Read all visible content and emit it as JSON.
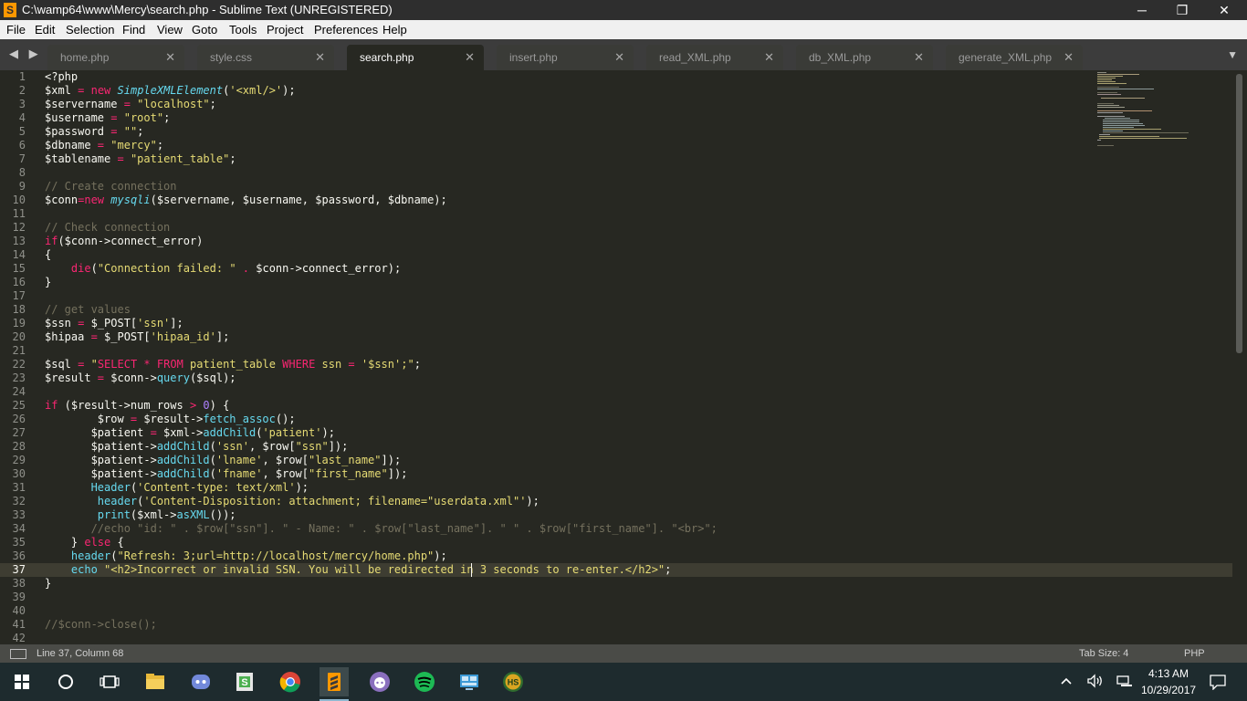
{
  "window": {
    "title": "C:\\wamp64\\www\\Mercy\\search.php - Sublime Text (UNREGISTERED)",
    "app_icon_letter": "S",
    "minimize_glyph": "─",
    "maximize_glyph": "❐",
    "close_glyph": "✕"
  },
  "menu": [
    {
      "label": "File"
    },
    {
      "label": "Edit"
    },
    {
      "label": "Selection"
    },
    {
      "label": "Find"
    },
    {
      "label": "View"
    },
    {
      "label": "Goto"
    },
    {
      "label": "Tools"
    },
    {
      "label": "Project"
    },
    {
      "label": "Preferences"
    },
    {
      "label": "Help"
    }
  ],
  "tab_nav": "◀ ▶",
  "tab_menu_glyph": "▼",
  "tabs": [
    {
      "label": "home.php",
      "close": "✕"
    },
    {
      "label": "style.css",
      "close": "✕"
    },
    {
      "label": "search.php",
      "close": "✕",
      "active": true
    },
    {
      "label": "insert.php",
      "close": "✕"
    },
    {
      "label": "read_XML.php",
      "close": "✕"
    },
    {
      "label": "db_XML.php",
      "close": "✕"
    },
    {
      "label": "generate_XML.php",
      "close": "✕"
    }
  ],
  "editor": {
    "line_numbers": [
      "1",
      "2",
      "3",
      "4",
      "5",
      "6",
      "7",
      "8",
      "9",
      "10",
      "11",
      "12",
      "13",
      "14",
      "15",
      "16",
      "17",
      "18",
      "19",
      "20",
      "21",
      "22",
      "23",
      "24",
      "25",
      "26",
      "27",
      "28",
      "29",
      "30",
      "31",
      "32",
      "33",
      "34",
      "35",
      "36",
      "37",
      "38",
      "39",
      "40",
      "41",
      "42"
    ],
    "current_line": 37,
    "code": [
      [
        {
          "t": "<?php"
        }
      ],
      [
        {
          "t": "$xml "
        },
        {
          "t": "=",
          "c": "kw"
        },
        {
          "t": " "
        },
        {
          "t": "new",
          "c": "kw"
        },
        {
          "t": " "
        },
        {
          "t": "SimpleXMLElement",
          "c": "cls"
        },
        {
          "t": "("
        },
        {
          "t": "'<xml/>'",
          "c": "str"
        },
        {
          "t": ");"
        }
      ],
      [
        {
          "t": "$servername "
        },
        {
          "t": "=",
          "c": "kw"
        },
        {
          "t": " "
        },
        {
          "t": "\"localhost\"",
          "c": "str"
        },
        {
          "t": ";"
        }
      ],
      [
        {
          "t": "$username "
        },
        {
          "t": "=",
          "c": "kw"
        },
        {
          "t": " "
        },
        {
          "t": "\"root\"",
          "c": "str"
        },
        {
          "t": ";"
        }
      ],
      [
        {
          "t": "$password "
        },
        {
          "t": "=",
          "c": "kw"
        },
        {
          "t": " "
        },
        {
          "t": "\"\"",
          "c": "str"
        },
        {
          "t": ";"
        }
      ],
      [
        {
          "t": "$dbname "
        },
        {
          "t": "=",
          "c": "kw"
        },
        {
          "t": " "
        },
        {
          "t": "\"mercy\"",
          "c": "str"
        },
        {
          "t": ";"
        }
      ],
      [
        {
          "t": "$tablename "
        },
        {
          "t": "=",
          "c": "kw"
        },
        {
          "t": " "
        },
        {
          "t": "\"patient_table\"",
          "c": "str"
        },
        {
          "t": ";"
        }
      ],
      [],
      [
        {
          "t": "// Create connection",
          "c": "cmt"
        }
      ],
      [
        {
          "t": "$conn"
        },
        {
          "t": "=",
          "c": "kw"
        },
        {
          "t": "new",
          "c": "kw"
        },
        {
          "t": " "
        },
        {
          "t": "mysqli",
          "c": "cls"
        },
        {
          "t": "($servername, $username, $password, $dbname);"
        }
      ],
      [],
      [
        {
          "t": "// Check connection",
          "c": "cmt"
        }
      ],
      [
        {
          "t": "if",
          "c": "kw"
        },
        {
          "t": "($conn->connect_error)"
        }
      ],
      [
        {
          "t": "{"
        }
      ],
      [
        {
          "t": "    "
        },
        {
          "t": "die",
          "c": "kw"
        },
        {
          "t": "("
        },
        {
          "t": "\"Connection failed: \"",
          "c": "str"
        },
        {
          "t": " "
        },
        {
          "t": ".",
          "c": "kw"
        },
        {
          "t": " $conn->connect_error);"
        }
      ],
      [
        {
          "t": "}"
        }
      ],
      [],
      [
        {
          "t": "// get values",
          "c": "cmt"
        }
      ],
      [
        {
          "t": "$ssn "
        },
        {
          "t": "=",
          "c": "kw"
        },
        {
          "t": " $_POST["
        },
        {
          "t": "'ssn'",
          "c": "str"
        },
        {
          "t": "];"
        }
      ],
      [
        {
          "t": "$hipaa "
        },
        {
          "t": "=",
          "c": "kw"
        },
        {
          "t": " $_POST["
        },
        {
          "t": "'hipaa_id'",
          "c": "str"
        },
        {
          "t": "];"
        }
      ],
      [],
      [
        {
          "t": "$sql "
        },
        {
          "t": "=",
          "c": "kw"
        },
        {
          "t": " "
        },
        {
          "t": "\"",
          "c": "str"
        },
        {
          "t": "SELECT",
          "c": "kw"
        },
        {
          "t": " "
        },
        {
          "t": "*",
          "c": "kw"
        },
        {
          "t": " "
        },
        {
          "t": "FROM",
          "c": "kw"
        },
        {
          "t": " patient_table ",
          "c": "str"
        },
        {
          "t": "WHERE",
          "c": "kw"
        },
        {
          "t": " ssn ",
          "c": "str"
        },
        {
          "t": "=",
          "c": "kw"
        },
        {
          "t": " '$ssn';\"",
          "c": "str"
        },
        {
          "t": ";"
        }
      ],
      [
        {
          "t": "$result "
        },
        {
          "t": "=",
          "c": "kw"
        },
        {
          "t": " $conn->"
        },
        {
          "t": "query",
          "c": "fn"
        },
        {
          "t": "($sql);"
        }
      ],
      [],
      [
        {
          "t": "if",
          "c": "kw"
        },
        {
          "t": " ($result->num_rows "
        },
        {
          "t": ">",
          "c": "kw"
        },
        {
          "t": " "
        },
        {
          "t": "0",
          "c": "num"
        },
        {
          "t": ") {"
        }
      ],
      [
        {
          "t": "        $row "
        },
        {
          "t": "=",
          "c": "kw"
        },
        {
          "t": " $result->"
        },
        {
          "t": "fetch_assoc",
          "c": "fn"
        },
        {
          "t": "();"
        }
      ],
      [
        {
          "t": "       $patient "
        },
        {
          "t": "=",
          "c": "kw"
        },
        {
          "t": " $xml->"
        },
        {
          "t": "addChild",
          "c": "fn"
        },
        {
          "t": "("
        },
        {
          "t": "'patient'",
          "c": "str"
        },
        {
          "t": ");"
        }
      ],
      [
        {
          "t": "       $patient->"
        },
        {
          "t": "addChild",
          "c": "fn"
        },
        {
          "t": "("
        },
        {
          "t": "'ssn'",
          "c": "str"
        },
        {
          "t": ", $row["
        },
        {
          "t": "\"ssn\"",
          "c": "str"
        },
        {
          "t": "]);"
        }
      ],
      [
        {
          "t": "       $patient->"
        },
        {
          "t": "addChild",
          "c": "fn"
        },
        {
          "t": "("
        },
        {
          "t": "'lname'",
          "c": "str"
        },
        {
          "t": ", $row["
        },
        {
          "t": "\"last_name\"",
          "c": "str"
        },
        {
          "t": "]);"
        }
      ],
      [
        {
          "t": "       $patient->"
        },
        {
          "t": "addChild",
          "c": "fn"
        },
        {
          "t": "("
        },
        {
          "t": "'fname'",
          "c": "str"
        },
        {
          "t": ", $row["
        },
        {
          "t": "\"first_name\"",
          "c": "str"
        },
        {
          "t": "]);"
        }
      ],
      [
        {
          "t": "       "
        },
        {
          "t": "Header",
          "c": "fn"
        },
        {
          "t": "("
        },
        {
          "t": "'Content-type: text/xml'",
          "c": "str"
        },
        {
          "t": ");"
        }
      ],
      [
        {
          "t": "        "
        },
        {
          "t": "header",
          "c": "fn"
        },
        {
          "t": "("
        },
        {
          "t": "'Content-Disposition: attachment; filename=\"userdata.xml\"'",
          "c": "str"
        },
        {
          "t": ");"
        }
      ],
      [
        {
          "t": "        "
        },
        {
          "t": "print",
          "c": "fn"
        },
        {
          "t": "($xml->"
        },
        {
          "t": "asXML",
          "c": "fn"
        },
        {
          "t": "());"
        }
      ],
      [
        {
          "t": "       //echo \"id: \" . $row[\"ssn\"]. \" - Name: \" . $row[\"last_name\"]. \" \" . $row[\"first_name\"]. \"<br>\";",
          "c": "cmt"
        }
      ],
      [
        {
          "t": "    } "
        },
        {
          "t": "else",
          "c": "kw"
        },
        {
          "t": " {"
        }
      ],
      [
        {
          "t": "    "
        },
        {
          "t": "header",
          "c": "fn"
        },
        {
          "t": "("
        },
        {
          "t": "\"Refresh: 3;url=http://localhost/mercy/home.php\"",
          "c": "str"
        },
        {
          "t": ");"
        }
      ],
      [
        {
          "t": "    "
        },
        {
          "t": "echo",
          "c": "fn"
        },
        {
          "t": " "
        },
        {
          "t": "\"<h2>Incorrect or invalid SSN. You will be redirected in 3 seconds to re-enter.</h2>\"",
          "c": "str"
        },
        {
          "t": ";"
        }
      ],
      [
        {
          "t": "}"
        }
      ],
      [],
      [],
      [
        {
          "t": "//$conn->close();",
          "c": "cmt"
        }
      ],
      []
    ]
  },
  "status": {
    "position": "Line 37, Column 68",
    "tab_size": "Tab Size: 4",
    "syntax": "PHP"
  },
  "taskbar": {
    "start_icon": "windows-logo-icon",
    "apps": [
      "cortana-icon",
      "task-view-icon",
      "file-explorer-icon",
      "discord-icon",
      "sublime-s-icon",
      "chrome-icon",
      "sublime-text-icon",
      "github-desktop-icon",
      "spotify-icon",
      "control-panel-icon",
      "hearthstone-icon"
    ],
    "time": "4:13 AM",
    "date": "10/29/2017"
  },
  "colors": {
    "editor_bg": "#272822",
    "keyword": "#f92672",
    "string": "#e6db74",
    "function": "#66d9ef",
    "comment": "#75715e",
    "number": "#ae81ff"
  }
}
